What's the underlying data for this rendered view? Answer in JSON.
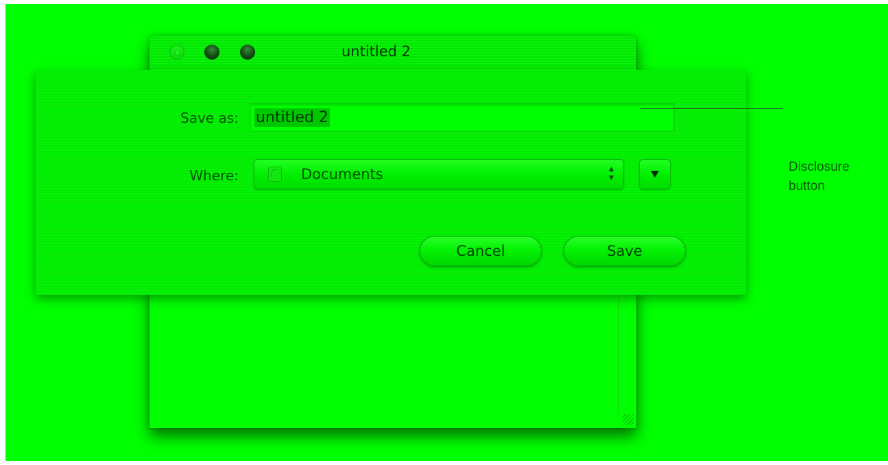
{
  "window": {
    "title": "untitled 2"
  },
  "save_sheet": {
    "save_as_label": "Save as:",
    "filename_value": "untitled 2",
    "where_label": "Where:",
    "where_value": "Documents",
    "cancel_label": "Cancel",
    "save_label": "Save"
  },
  "callout": {
    "line1": "Disclosure",
    "line2": "button"
  },
  "icons": {
    "close": "close-icon",
    "minimize": "minimize-icon",
    "zoom": "zoom-icon",
    "folder": "folder-icon",
    "popup_arrows": "up-down-arrows-icon",
    "disclosure": "disclosure-triangle-icon",
    "resize": "resize-grip-icon"
  },
  "colors": {
    "background": "#00ff00",
    "text": "#004200",
    "selection": "#00c800"
  }
}
